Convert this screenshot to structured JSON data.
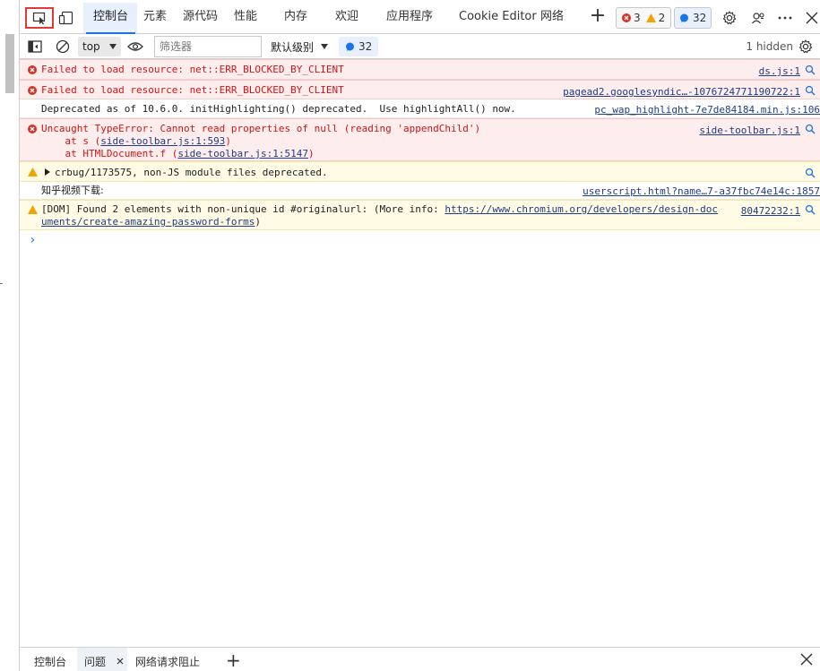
{
  "tabs": [
    {
      "label": "控制台",
      "active": true
    },
    {
      "label": "元素"
    },
    {
      "label": "源代码"
    },
    {
      "label": "性能"
    },
    {
      "label": "内存"
    },
    {
      "label": "欢迎"
    },
    {
      "label": "应用程序"
    },
    {
      "label": "Cookie Editor"
    },
    {
      "label": "网络"
    }
  ],
  "issue_counts": {
    "errors": "3",
    "warnings": "2",
    "messages": "32"
  },
  "toolbar": {
    "context": "top",
    "filter_placeholder": "筛选器",
    "levels": "默认级别",
    "message_count": "32",
    "hidden": "1 hidden"
  },
  "messages": [
    {
      "level": "error",
      "text": "Failed to load resource: net::ERR_BLOCKED_BY_CLIENT",
      "source": "ds.js:1"
    },
    {
      "level": "error",
      "text": "Failed to load resource: net::ERR_BLOCKED_BY_CLIENT",
      "source": "pagead2.googlesyndic…-1076724771190722:1"
    },
    {
      "level": "info",
      "text": "Deprecated as of 10.6.0. initHighlighting() deprecated.  Use highlightAll() now.",
      "source": "pc_wap_highlight-7e7de84184.min.js:106"
    },
    {
      "level": "error",
      "text": "Uncaught TypeError: Cannot read properties of null (reading 'appendChild')",
      "stack1_prefix": "    at s (",
      "stack1_link": "side-toolbar.js:1:593",
      "stack1_suffix": ")",
      "stack2_prefix": "    at HTMLDocument.f (",
      "stack2_link": "side-toolbar.js:1:5147",
      "stack2_suffix": ")",
      "source": "side-toolbar.js:1"
    },
    {
      "level": "warn",
      "text": "crbug/1173575, non-JS module files deprecated."
    },
    {
      "level": "info",
      "text": "知乎视频下载:",
      "source": "userscript.html?name…7-a37fbc74e14c:1857"
    },
    {
      "level": "warn",
      "text_prefix": "[DOM] Found 2 elements with non-unique id #originalurl: (More info: ",
      "link_line1": "https://www.chromium.org/developers/design-doc",
      "link_line2": "uments/create-amazing-password-forms",
      "text_suffix": ")",
      "source": "80472232:1"
    }
  ],
  "prompt": "›",
  "drawer": {
    "tabs": [
      {
        "label": "控制台"
      },
      {
        "label": "问题",
        "active": true
      },
      {
        "label": "网络请求阻止"
      }
    ]
  },
  "colors": {
    "accent": "#1a73e8",
    "error": "#d11515",
    "warning": "#f0a400"
  }
}
